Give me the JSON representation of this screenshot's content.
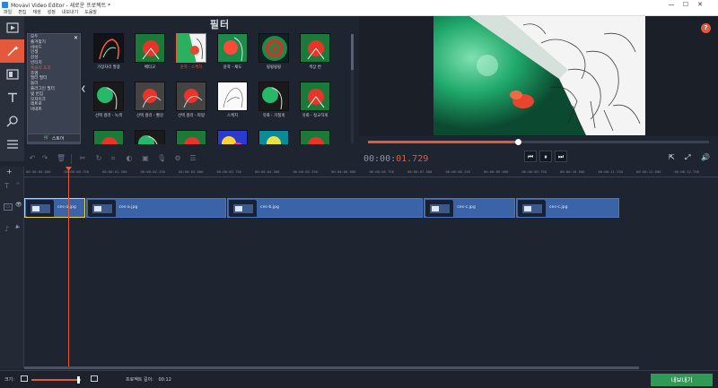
{
  "window": {
    "title": "Movavi Video Editor - 새로운 프로젝트 *",
    "minimize": "—",
    "maximize": "☐",
    "close": "✕"
  },
  "menu": [
    "파일",
    "편집",
    "재생",
    "설정",
    "내보내기",
    "도움말"
  ],
  "sidebar_tools": [
    {
      "icon": "film-icon"
    },
    {
      "icon": "magic-wand-icon",
      "active": true
    },
    {
      "icon": "transition-icon"
    },
    {
      "icon": "text-icon"
    },
    {
      "icon": "zoom-icon"
    },
    {
      "icon": "list-icon"
    }
  ],
  "filters_panel": {
    "title": "필터",
    "categories": [
      "모두",
      "즐겨찾기",
      "비비드",
      "인생",
      "감성",
      "빈티지",
      "예술적 효과",
      "조명",
      "필터 필터",
      "블러",
      "플러그인 필터",
      "빛 번짐",
      "모자이크",
      "레트로",
      "비네트"
    ],
    "selected_category": "예술적 효과",
    "store_label": "스토어",
    "items": [
      {
        "label": "가장자리 발광",
        "style": "glow"
      },
      {
        "label": "배타교",
        "style": "red"
      },
      {
        "label": "윤곽 - 스케치",
        "style": "sketch",
        "selected": true
      },
      {
        "label": "윤곽 - 채도",
        "style": "sat"
      },
      {
        "label": "윙윙윙윙",
        "style": "swirl"
      },
      {
        "label": "색상 변",
        "style": "red"
      },
      {
        "label": "선택 컬러 - 녹색",
        "style": "green"
      },
      {
        "label": "선택 컬러 - 빨강",
        "style": "gray"
      },
      {
        "label": "선택 컬러 - 파랑",
        "style": "gray"
      },
      {
        "label": "스케치",
        "style": "pencil"
      },
      {
        "label": "유화 - 거칠게",
        "style": "green"
      },
      {
        "label": "유화 - 정교하게",
        "style": "red"
      },
      {
        "label": "",
        "style": "red"
      },
      {
        "label": "",
        "style": "green"
      },
      {
        "label": "",
        "style": "red"
      },
      {
        "label": "",
        "style": "rainbow"
      },
      {
        "label": "",
        "style": "cyan"
      },
      {
        "label": "",
        "style": "red"
      }
    ]
  },
  "player": {
    "timecode_prefix": "00:00:",
    "timecode_seconds": "01.729",
    "progress": 0.44
  },
  "ruler_ticks": [
    "00:00:00.000",
    "00:00:00.750",
    "00:00:01.500",
    "00:00:02.250",
    "00:00:03.000",
    "00:00:03.750",
    "00:00:04.500",
    "00:00:05.250",
    "00:00:06.000",
    "00:00:06.750",
    "00:00:07.500",
    "00:00:08.250",
    "00:00:09.000",
    "00:00:09.750",
    "00:00:10.500",
    "00:00:11.250",
    "00:00:12.000",
    "00:00:12.750"
  ],
  "clips": [
    {
      "name": "ces-a.jpg",
      "start_s": 0.0,
      "end_s": 1.0,
      "selected": true
    },
    {
      "name": "ces-a.jpg",
      "start_s": 1.0,
      "end_s": 3.3
    },
    {
      "name": "ces-b.jpg",
      "start_s": 3.3,
      "end_s": 6.5
    },
    {
      "name": "ces-c.jpg",
      "start_s": 6.5,
      "end_s": 8.0
    },
    {
      "name": "ces-c.jpg",
      "start_s": 8.0,
      "end_s": 9.7
    }
  ],
  "bottom": {
    "zoom_label": "크기:",
    "project_duration_label": "프로젝트 길이:",
    "project_duration": "00:12",
    "export_label": "내보내기"
  },
  "colors": {
    "accent": "#e4583c",
    "clip": "#3a63a8",
    "export": "#2f9a56",
    "background": "#1f2530"
  }
}
